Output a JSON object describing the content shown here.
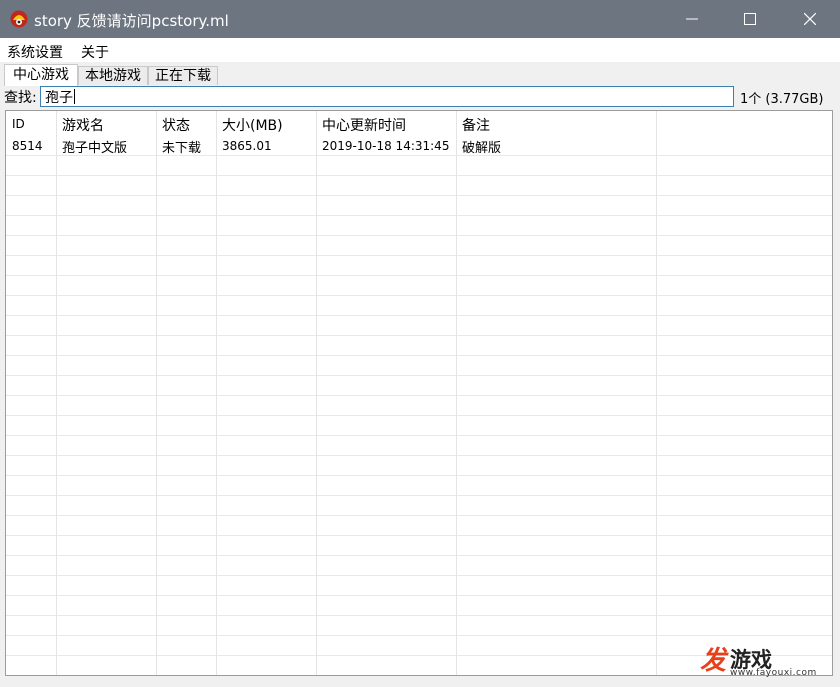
{
  "window": {
    "title": "story 反馈请访问pcstory.ml"
  },
  "menu": [
    {
      "label": "系统设置"
    },
    {
      "label": "关于"
    }
  ],
  "tabs": [
    {
      "label": "中心游戏",
      "active": true
    },
    {
      "label": "本地游戏",
      "active": false
    },
    {
      "label": "正在下载",
      "active": false
    }
  ],
  "search": {
    "label": "查找:",
    "value": "孢子",
    "result": "1个 (3.77GB)"
  },
  "table": {
    "columns": [
      "ID",
      "游戏名",
      "状态",
      "大小(MB)",
      "中心更新时间",
      "备注"
    ],
    "rows": [
      [
        "8514",
        "孢子中文版",
        "未下载",
        "3865.01",
        "2019-10-18 14:31:45",
        "破解版"
      ]
    ]
  },
  "watermark": {
    "brand_first": "发",
    "brand_rest": "游戏",
    "url": "www.fayouxi.com"
  },
  "colors": {
    "titlebar": "#6c7580",
    "input_border": "#3c7fb1",
    "watermark_accent": "#e8401a"
  }
}
